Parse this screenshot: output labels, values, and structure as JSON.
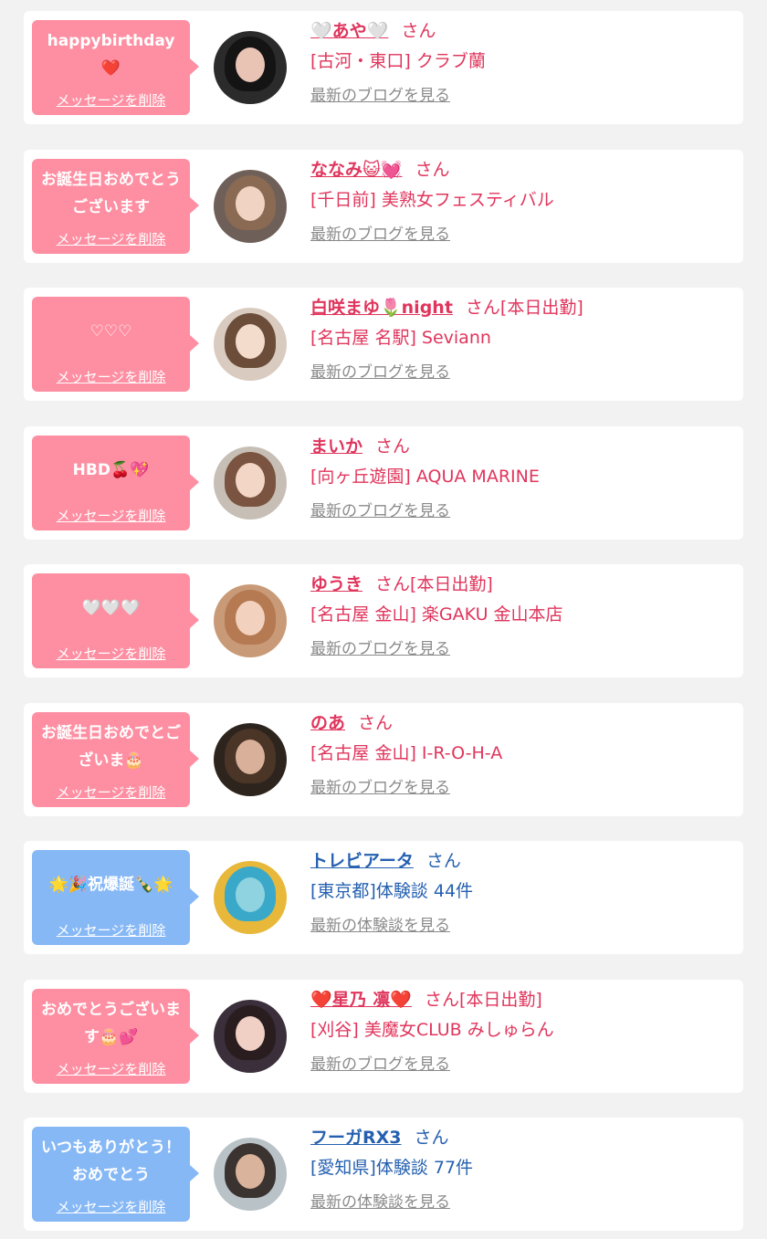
{
  "delete_label": "メッセージを削除",
  "cards": [
    {
      "theme": "pink",
      "message": "happybirthday\n❤️",
      "message_style": "bold",
      "name": "🤍あや🤍",
      "suffix": "さん",
      "shop": "[古河・東口] クラブ蘭",
      "link": "最新のブログを見る",
      "avatar": {
        "bg": "#2b2b2b",
        "hair": "#141414",
        "face": "#e9c4b4"
      }
    },
    {
      "theme": "pink",
      "message": "お誕生日おめでとうございます",
      "message_style": "bold",
      "name": "ななみ😺💓",
      "suffix": "さん",
      "shop": "[千日前] 美熟女フェスティバル",
      "link": "最新のブログを見る",
      "avatar": {
        "bg": "#6e5f58",
        "hair": "#8a6a52",
        "face": "#f1d3c4"
      }
    },
    {
      "theme": "pink",
      "message": "♡♡♡",
      "message_style": "light",
      "name": "白咲まゆ🌷night",
      "suffix": "さん[本日出勤]",
      "shop": "[名古屋 名駅] Seviann",
      "link": "最新のブログを見る",
      "avatar": {
        "bg": "#d9cbbf",
        "hair": "#6b4d3a",
        "face": "#f4dccd"
      }
    },
    {
      "theme": "pink",
      "message": "HBD🍒💖",
      "message_style": "bold",
      "name": "まいか",
      "suffix": "さん",
      "shop": "[向ヶ丘遊園] AQUA MARINE",
      "link": "最新のブログを見る",
      "avatar": {
        "bg": "#c7bfb6",
        "hair": "#7a5440",
        "face": "#f3d6c6"
      }
    },
    {
      "theme": "pink",
      "message": "🤍🤍🤍",
      "message_style": "bold",
      "name": "ゆうき",
      "suffix": "さん[本日出勤]",
      "shop": "[名古屋 金山] 楽GAKU 金山本店",
      "link": "最新のブログを見る",
      "avatar": {
        "bg": "#c99a78",
        "hair": "#b57a52",
        "face": "#f2d2bf"
      }
    },
    {
      "theme": "pink",
      "message": "お誕生日おめでとございま🎂",
      "message_style": "bold",
      "name": "のあ",
      "suffix": "さん",
      "shop": "[名古屋 金山] I-R-O-H-A",
      "link": "最新のブログを見る",
      "avatar": {
        "bg": "#2e241e",
        "hair": "#4a3526",
        "face": "#d9b09a"
      }
    },
    {
      "theme": "blue",
      "message": "🌟🎉祝爆誕🍾🌟",
      "message_style": "bold",
      "name": "トレビアータ",
      "suffix": "さん",
      "shop": "[東京都]体験談 44件",
      "link": "最新の体験談を見る",
      "avatar": {
        "bg": "#e8b83a",
        "hair": "#3aa9c9",
        "face": "#8fd3e0"
      }
    },
    {
      "theme": "pink",
      "message": "おめでとうございます🎂💕",
      "message_style": "bold",
      "name": "❤️星乃 凛❤️",
      "suffix": "さん[本日出勤]",
      "shop": "[刈谷] 美魔女CLUB みしゅらん",
      "link": "最新のブログを見る",
      "avatar": {
        "bg": "#3a2f3a",
        "hair": "#2a1d20",
        "face": "#f0cfc4"
      }
    },
    {
      "theme": "blue",
      "message": "いつもありがとう！おめでとう",
      "message_style": "bold",
      "name": "フーガRX3",
      "suffix": "さん",
      "shop": "[愛知県]体験談 77件",
      "link": "最新の体験談を見る",
      "avatar": {
        "bg": "#b9c2c7",
        "hair": "#3b3330",
        "face": "#d9b39b"
      }
    }
  ]
}
